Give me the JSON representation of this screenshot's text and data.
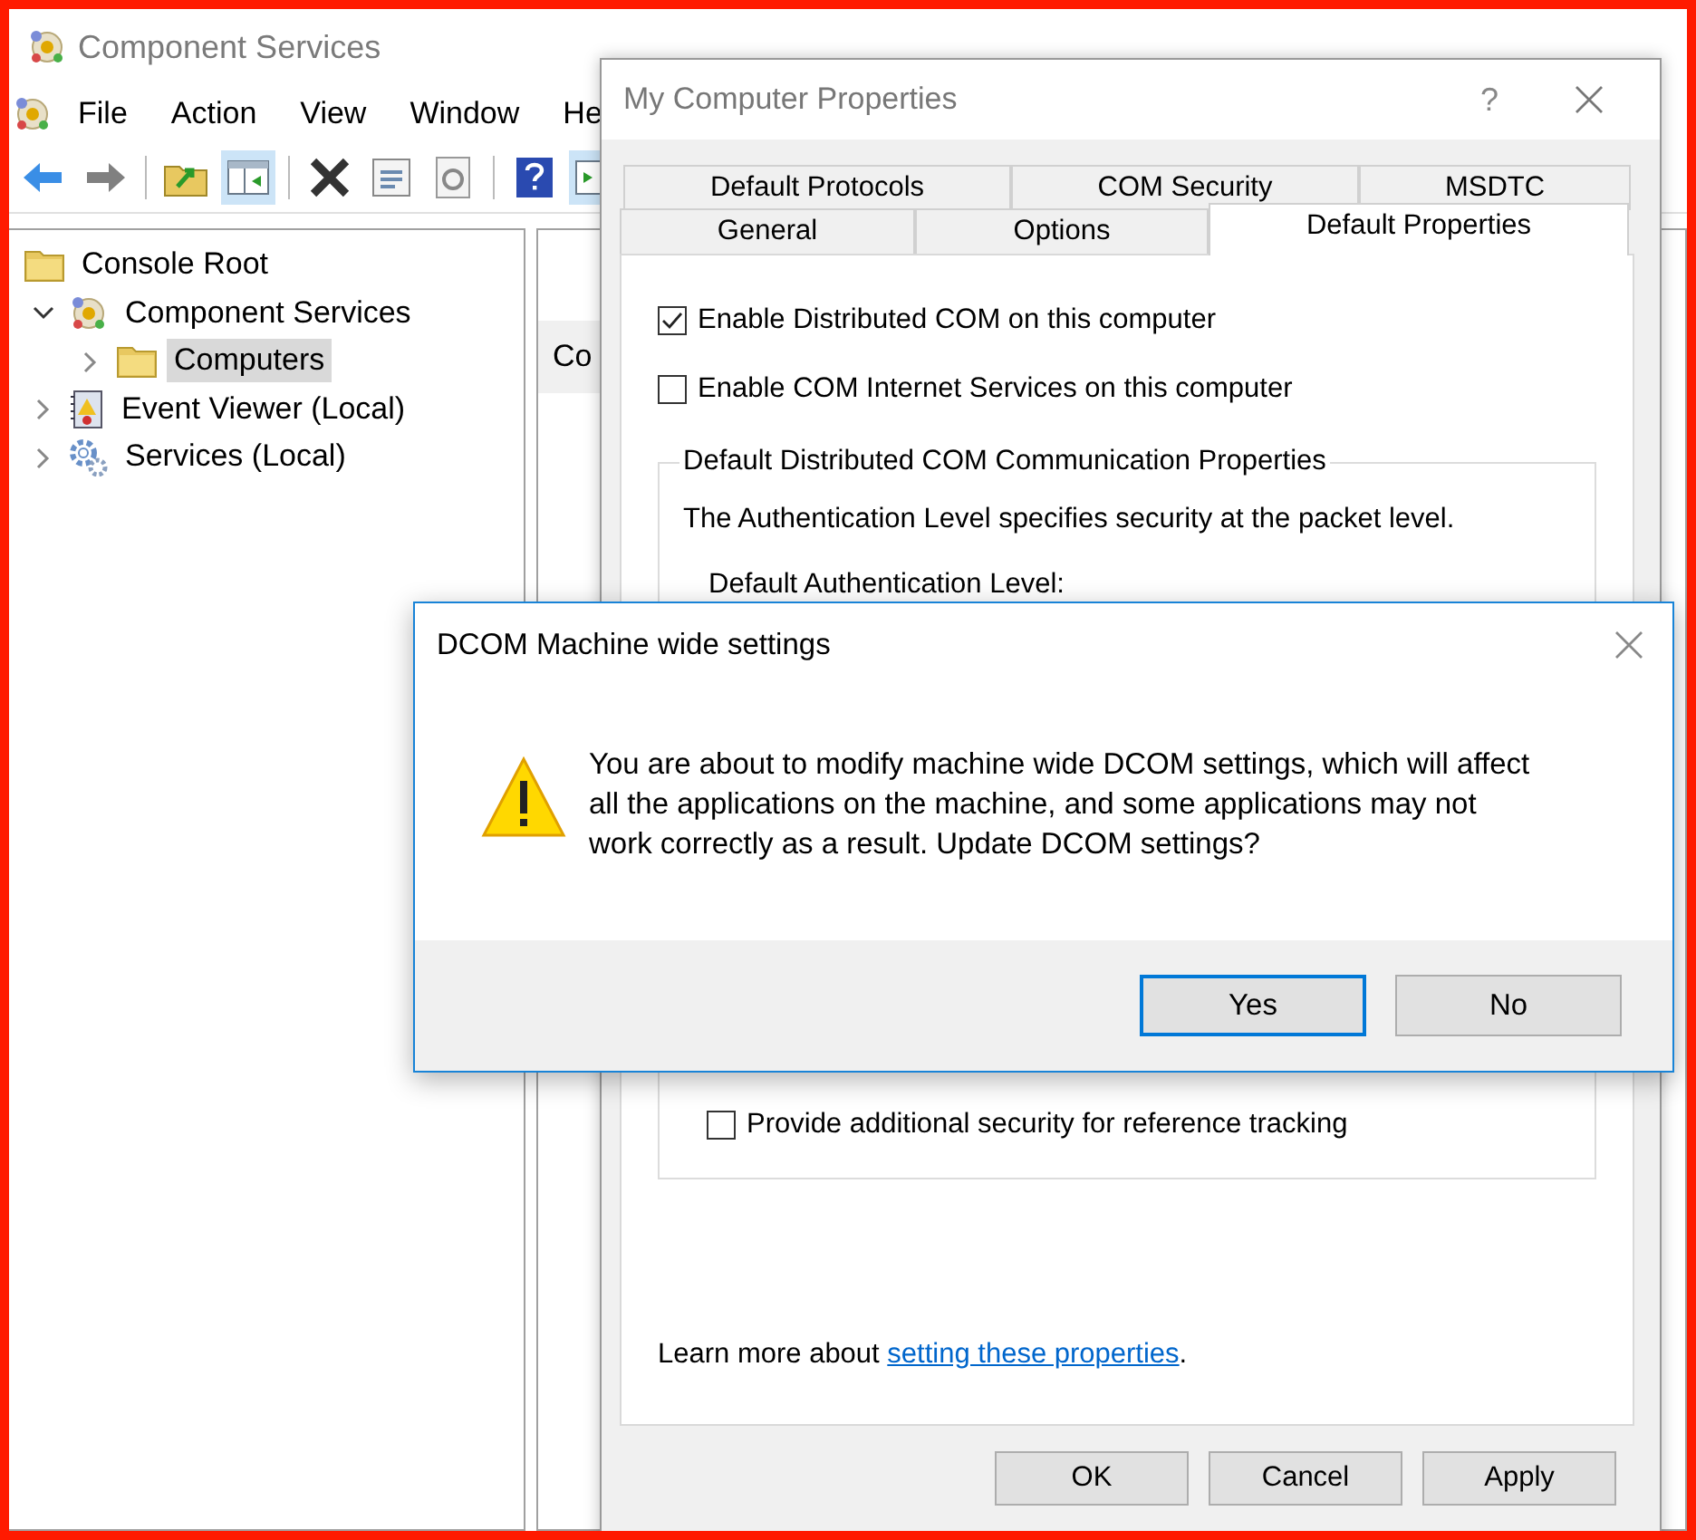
{
  "main_window": {
    "title": "Component Services",
    "menu": [
      "File",
      "Action",
      "View",
      "Window",
      "He"
    ],
    "tree": [
      {
        "label": "Console Root",
        "kind": "folder",
        "selected": false,
        "children": [
          {
            "label": "Component Services",
            "kind": "app",
            "selected": false,
            "expanded": true,
            "children": [
              {
                "label": "Computers",
                "kind": "folder",
                "selected": true,
                "expanded": false
              }
            ]
          },
          {
            "label": "Event Viewer (Local)",
            "kind": "log",
            "selected": false,
            "expanded": false
          },
          {
            "label": "Services (Local)",
            "kind": "gears",
            "selected": false,
            "expanded": false
          }
        ]
      }
    ],
    "content_heading": "Co"
  },
  "properties_dialog": {
    "title": "My Computer Properties",
    "help": "?",
    "tab_rows": [
      [
        {
          "label": "Default Protocols",
          "selected": false
        },
        {
          "label": "COM Security",
          "selected": false
        },
        {
          "label": "MSDTC",
          "selected": false
        }
      ],
      [
        {
          "label": "General",
          "selected": false
        },
        {
          "label": "Options",
          "selected": false
        },
        {
          "label": "Default Properties",
          "selected": true
        }
      ]
    ],
    "options": [
      {
        "label": "Enable Distributed COM on this computer",
        "checked": true
      },
      {
        "label": "Enable COM Internet Services on this computer",
        "checked": false
      }
    ],
    "group": {
      "title": "Default Distributed COM Communication Properties",
      "description": "The Authentication Level specifies security at the packet level.",
      "field_label": "Default Authentication Level:",
      "options": [
        {
          "label": "Provide additional security for reference tracking",
          "checked": false
        }
      ]
    },
    "learn_more": {
      "text": "Learn more about ",
      "link": "setting these properties",
      "after": "."
    },
    "buttons": [
      "OK",
      "Cancel",
      "Apply"
    ]
  },
  "message_dialog": {
    "title": "DCOM Machine wide settings",
    "message": "You are about to modify machine wide DCOM settings, which will affect all the applications on the machine, and some applications may not work correctly as a result. Update DCOM settings?",
    "buttons": [
      {
        "label": "Yes",
        "default": true
      },
      {
        "label": "No",
        "default": false
      }
    ]
  }
}
